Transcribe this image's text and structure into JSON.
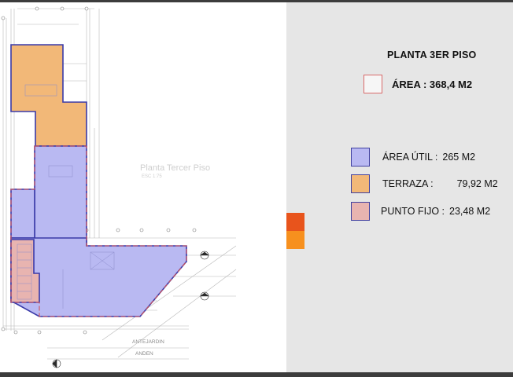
{
  "plan": {
    "title": "Planta Tercer Piso",
    "scale": "ESC 1:75",
    "street_label_1": "ANTEJARDIN",
    "street_label_2": "ANDEN"
  },
  "legend": {
    "title": "PLANTA 3ER PISO",
    "total_area": "ÁREA : 368,4 M2",
    "items": [
      {
        "label": "ÁREA ÚTIL :",
        "value": "265 M2",
        "color": "#b9b9f2"
      },
      {
        "label": "TERRAZA :",
        "value": "79,92 M2",
        "color": "#f2b878"
      },
      {
        "label": "PUNTO FIJO :",
        "value": "23,48 M2",
        "color": "#e8b4b0"
      }
    ]
  },
  "colors": {
    "useful_fill": "#b9b9f2",
    "terrace_fill": "#f2b878",
    "fixed_fill": "#e8b4b0",
    "outline_blue": "#3a3aa8",
    "outline_red": "#d2545a",
    "accent_red": "#e8541c",
    "accent_orange": "#f7901e",
    "panel_gray": "#e6e6e6"
  }
}
